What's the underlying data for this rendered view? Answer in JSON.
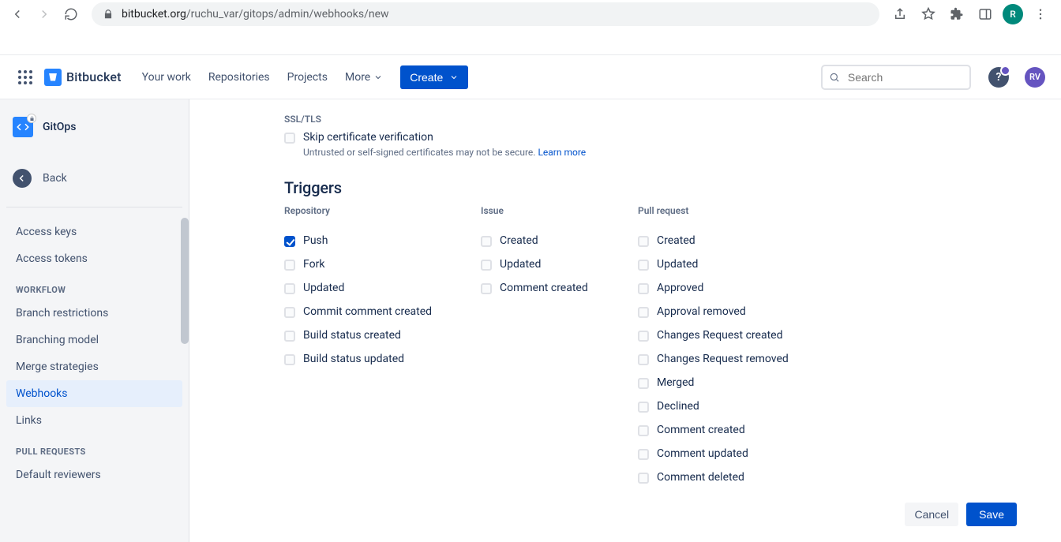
{
  "browser": {
    "url_host": "bitbucket.org",
    "url_path": "/ruchu_var/gitops/admin/webhooks/new",
    "avatar_initial": "R"
  },
  "topnav": {
    "product": "Bitbucket",
    "links": {
      "your_work": "Your work",
      "repositories": "Repositories",
      "projects": "Projects",
      "more": "More"
    },
    "create_label": "Create",
    "search_placeholder": "Search",
    "help_glyph": "?",
    "user_initials": "RV"
  },
  "sidebar": {
    "repo_name": "GitOps",
    "back_label": "Back",
    "items_top": {
      "access_keys": "Access keys",
      "access_tokens": "Access tokens"
    },
    "heading_workflow": "WORKFLOW",
    "items_workflow": {
      "branch_restrictions": "Branch restrictions",
      "branching_model": "Branching model",
      "merge_strategies": "Merge strategies",
      "webhooks": "Webhooks",
      "links": "Links"
    },
    "heading_pull": "PULL REQUESTS",
    "items_pull": {
      "default_reviewers": "Default reviewers"
    }
  },
  "form": {
    "ssl_section": "SSL/TLS",
    "skip_cert_label": "Skip certificate verification",
    "skip_cert_help": "Untrusted or self-signed certificates may not be secure.",
    "skip_cert_link": "Learn more",
    "triggers_heading": "Triggers",
    "columns": {
      "repository": {
        "title": "Repository",
        "items": [
          {
            "label": "Push",
            "checked": true
          },
          {
            "label": "Fork",
            "checked": false
          },
          {
            "label": "Updated",
            "checked": false
          },
          {
            "label": "Commit comment created",
            "checked": false
          },
          {
            "label": "Build status created",
            "checked": false
          },
          {
            "label": "Build status updated",
            "checked": false
          }
        ]
      },
      "issue": {
        "title": "Issue",
        "items": [
          {
            "label": "Created",
            "checked": false
          },
          {
            "label": "Updated",
            "checked": false
          },
          {
            "label": "Comment created",
            "checked": false
          }
        ]
      },
      "pull_request": {
        "title": "Pull request",
        "items": [
          {
            "label": "Created",
            "checked": false
          },
          {
            "label": "Updated",
            "checked": false
          },
          {
            "label": "Approved",
            "checked": false
          },
          {
            "label": "Approval removed",
            "checked": false
          },
          {
            "label": "Changes Request created",
            "checked": false
          },
          {
            "label": "Changes Request removed",
            "checked": false
          },
          {
            "label": "Merged",
            "checked": false
          },
          {
            "label": "Declined",
            "checked": false
          },
          {
            "label": "Comment created",
            "checked": false
          },
          {
            "label": "Comment updated",
            "checked": false
          },
          {
            "label": "Comment deleted",
            "checked": false
          }
        ]
      }
    },
    "cancel_label": "Cancel",
    "save_label": "Save"
  }
}
